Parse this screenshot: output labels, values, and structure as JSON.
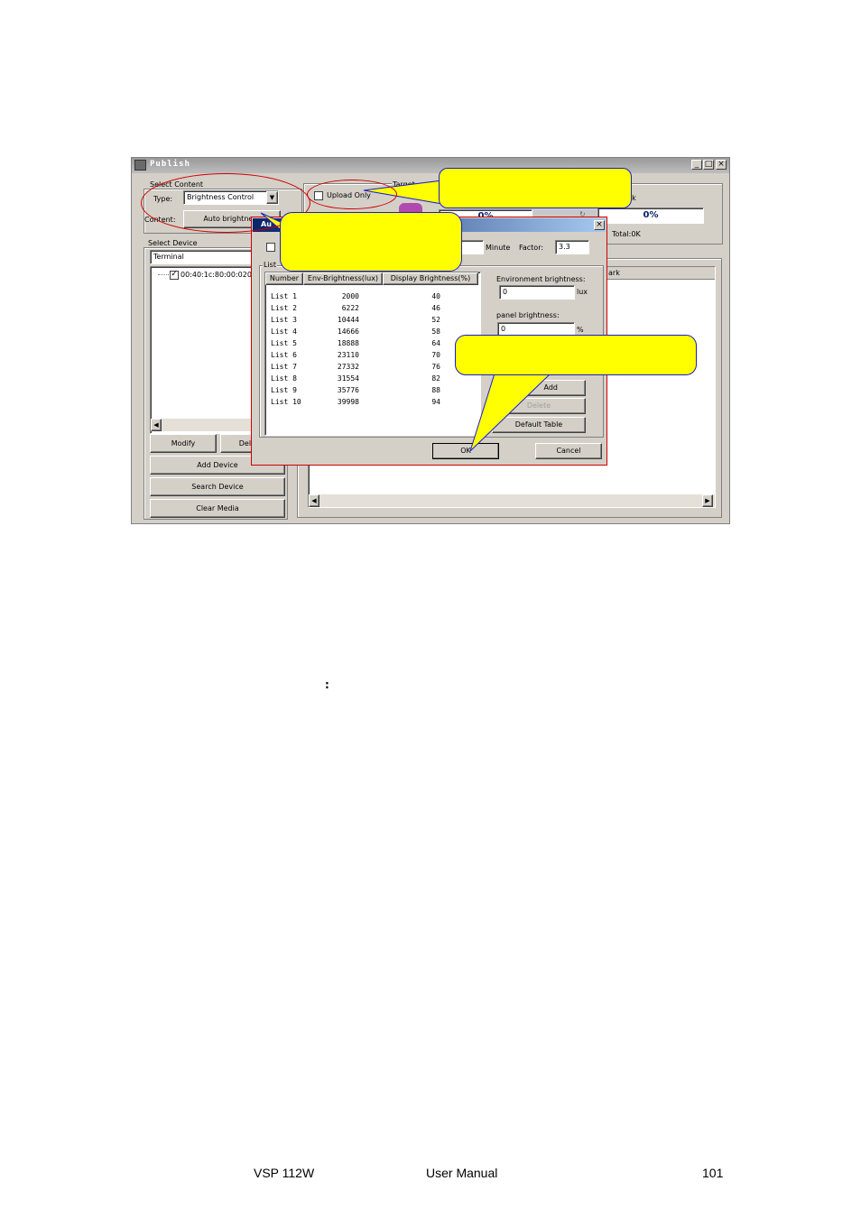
{
  "window": {
    "title": "Publish",
    "minimize": "_",
    "maximize": "□",
    "close": "×"
  },
  "select_content": {
    "group_label": "Select Content",
    "type_label": "Type:",
    "type_value": "Brightness Control",
    "content_label": "Content:",
    "content_button": "Auto brightness"
  },
  "upload_only": "Upload Only",
  "target": {
    "group_label": "Target",
    "progress_left": "0%",
    "progress_right": "0%",
    "status_partial": "sk",
    "total": "Total:0K",
    "column_partial": "ark"
  },
  "select_device": {
    "group_label": "Select Device",
    "dropdown_value": "Terminal",
    "device": "00:40:1c:80:00:020",
    "modify_button": "Modify",
    "delete_button": "Dele",
    "add_device_button": "Add Device",
    "search_device_button": "Search Device",
    "clear_media_button": "Clear Media"
  },
  "dialog": {
    "title_partial": "Au",
    "minute_label": "Minute",
    "factor_label": "Factor:",
    "factor_value": "3.3",
    "list_group_label": "List",
    "columns": [
      "Number",
      "Env-Brightness(lux)",
      "Display Brightness(%)"
    ],
    "rows": [
      {
        "number": "List 1",
        "env": "2000",
        "display": "40"
      },
      {
        "number": "List 2",
        "env": "6222",
        "display": "46"
      },
      {
        "number": "List 3",
        "env": "10444",
        "display": "52"
      },
      {
        "number": "List 4",
        "env": "14666",
        "display": "58"
      },
      {
        "number": "List 5",
        "env": "18888",
        "display": "64"
      },
      {
        "number": "List 6",
        "env": "23110",
        "display": "70"
      },
      {
        "number": "List 7",
        "env": "27332",
        "display": "76"
      },
      {
        "number": "List 8",
        "env": "31554",
        "display": "82"
      },
      {
        "number": "List 9",
        "env": "35776",
        "display": "88"
      },
      {
        "number": "List 10",
        "env": "39998",
        "display": "94"
      }
    ],
    "env_brightness_label": "Environment brightness:",
    "env_brightness_value": "0",
    "env_unit": "lux",
    "panel_brightness_label": "panel brightness:",
    "panel_brightness_value": "0",
    "panel_unit": "%",
    "add_button": "Add",
    "delete_button": "Delete",
    "default_table_button": "Default Table",
    "ok_button": "OK",
    "cancel_button": "Cancel",
    "close": "×"
  },
  "text_colon": ":",
  "footer": {
    "product": "VSP 112W",
    "doc": "User Manual",
    "page": "101"
  },
  "colors": {
    "callout_fill": "#ffff00",
    "callout_border": "#1c1ccc",
    "highlight_ring": "#d00000",
    "window_face": "#d4d0c8"
  }
}
